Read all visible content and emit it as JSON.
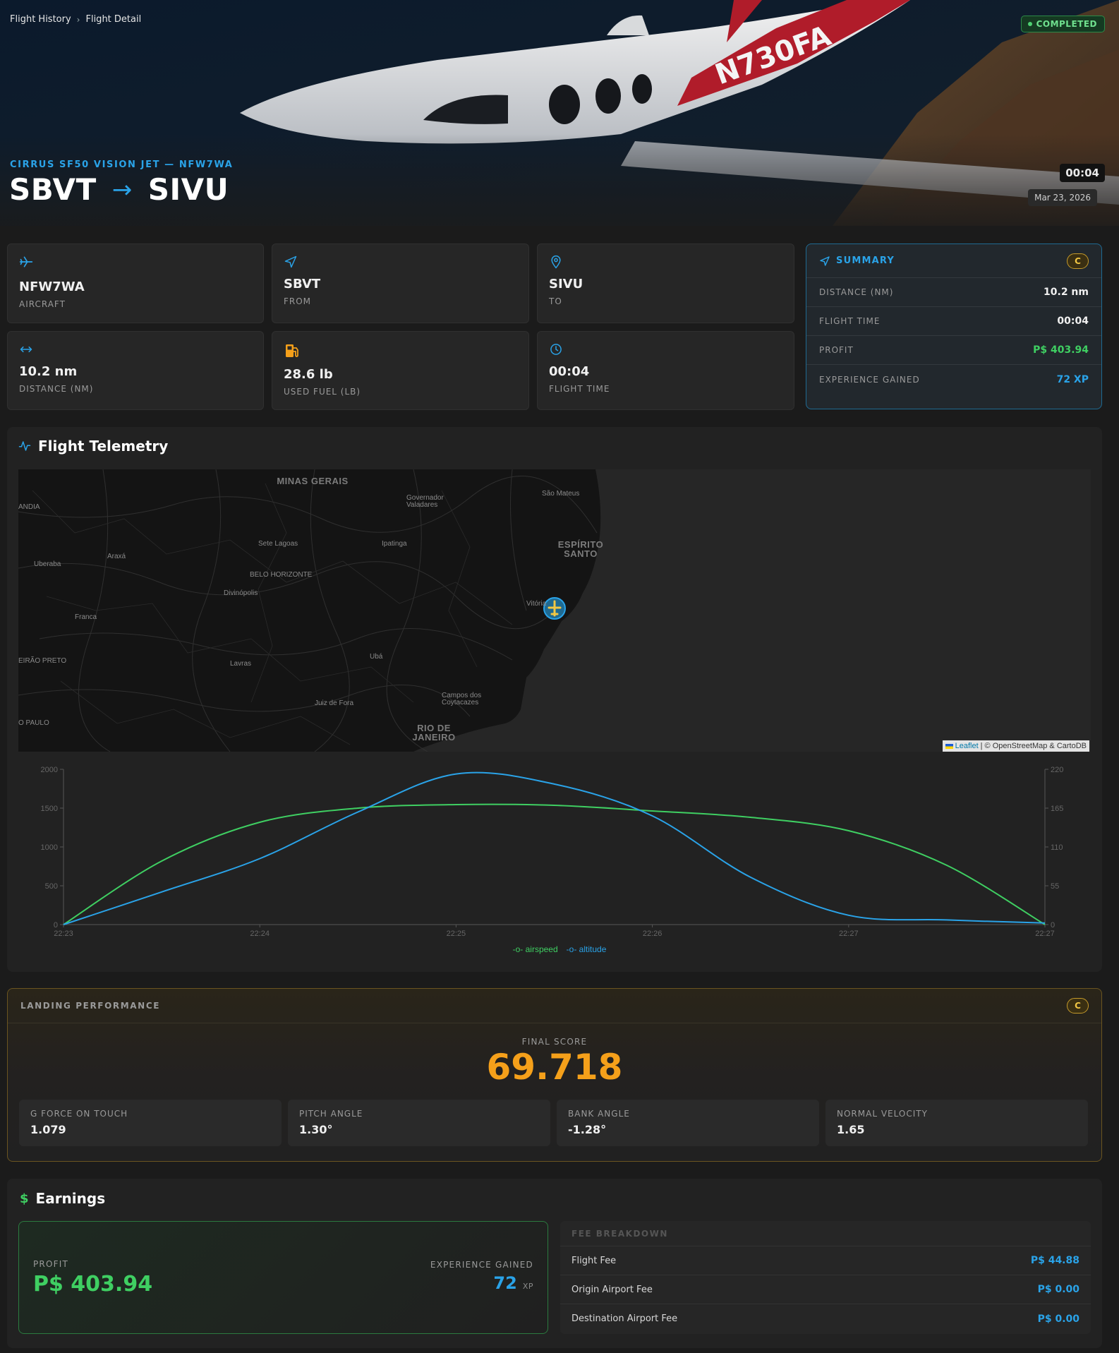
{
  "breadcrumb": {
    "items": [
      "Flight History",
      "Flight Detail"
    ],
    "separator": "›"
  },
  "status_badge": "COMPLETED",
  "header": {
    "aircraft_line": "CIRRUS SF50 VISION JET — NFW7WA",
    "origin": "SBVT",
    "arrow": "→",
    "destination": "SIVU",
    "duration": "00:04",
    "date": "Mar 23, 2026",
    "hero_tail_text": "N730FA"
  },
  "stats": [
    {
      "icon": "plane-icon",
      "value": "NFW7WA",
      "label": "AIRCRAFT"
    },
    {
      "icon": "navigation-arrow-icon",
      "value": "SBVT",
      "label": "FROM"
    },
    {
      "icon": "map-pin-icon",
      "value": "SIVU",
      "label": "TO"
    },
    {
      "icon": "distance-arrows-icon",
      "value": "10.2 nm",
      "label": "DISTANCE (NM)"
    },
    {
      "icon": "fuel-pump-icon",
      "value": "28.6 lb",
      "label": "USED FUEL (LB)"
    },
    {
      "icon": "clock-icon",
      "value": "00:04",
      "label": "FLIGHT TIME"
    }
  ],
  "summary": {
    "title": "SUMMARY",
    "grade": "C",
    "rows": [
      {
        "label": "DISTANCE (NM)",
        "value": "10.2 nm",
        "color": "#f0f0f0"
      },
      {
        "label": "FLIGHT TIME",
        "value": "00:04",
        "color": "#f0f0f0"
      },
      {
        "label": "PROFIT",
        "value": "P$ 403.94",
        "color": "#3fcf62"
      },
      {
        "label": "EXPERIENCE GAINED",
        "value": "72 XP",
        "color": "#2aa3e8"
      }
    ]
  },
  "telemetry": {
    "title": "Flight Telemetry",
    "map": {
      "attribution_link": "Leaflet",
      "attribution_text": "| © OpenStreetMap & CartoDB",
      "labels": [
        {
          "text": "MINAS GERAIS",
          "big": true
        },
        {
          "text": "São Mateus"
        },
        {
          "text": "Governador Valadares"
        },
        {
          "text": "ANDIA"
        },
        {
          "text": "Sete Lagoas"
        },
        {
          "text": "Ipatinga"
        },
        {
          "text": "ESPÍRITO SANTO",
          "big": true
        },
        {
          "text": "Uberaba"
        },
        {
          "text": "Araxá"
        },
        {
          "text": "BELO HORIZONTE"
        },
        {
          "text": "Divinópolis"
        },
        {
          "text": "Vitória"
        },
        {
          "text": "Franca"
        },
        {
          "text": "EIRÃO PRETO"
        },
        {
          "text": "Lavras"
        },
        {
          "text": "Ubá"
        },
        {
          "text": "Juiz de Fora"
        },
        {
          "text": "Campos dos Coytacazes"
        },
        {
          "text": "O PAULO"
        },
        {
          "text": "RIO DE JANEIRO",
          "big": true
        }
      ]
    }
  },
  "chart_data": {
    "type": "line",
    "x": [
      "22:23",
      "22:24",
      "22:25",
      "22:26",
      "22:27",
      "22:27"
    ],
    "x_positions_minutes": [
      0,
      1,
      2,
      3,
      4,
      5
    ],
    "series": [
      {
        "name": "airspeed",
        "axis": "right",
        "color": "#3fcf62",
        "points": [
          [
            0,
            0
          ],
          [
            0.5,
            90
          ],
          [
            1,
            145
          ],
          [
            1.5,
            165
          ],
          [
            2,
            170
          ],
          [
            2.5,
            169
          ],
          [
            3,
            161
          ],
          [
            3.5,
            152
          ],
          [
            4,
            133
          ],
          [
            4.5,
            84
          ],
          [
            5,
            0
          ]
        ]
      },
      {
        "name": "altitude",
        "axis": "left",
        "color": "#2aa3e8",
        "points": [
          [
            0,
            0
          ],
          [
            0.5,
            420
          ],
          [
            1,
            850
          ],
          [
            1.5,
            1450
          ],
          [
            2,
            1940
          ],
          [
            2.5,
            1810
          ],
          [
            3,
            1400
          ],
          [
            3.5,
            610
          ],
          [
            4,
            120
          ],
          [
            4.5,
            60
          ],
          [
            5,
            20
          ]
        ]
      }
    ],
    "y_left": {
      "ticks": [
        0,
        500,
        1000,
        1500,
        2000
      ],
      "range": [
        0,
        2000
      ]
    },
    "y_right": {
      "ticks": [
        0,
        55,
        110,
        165,
        220
      ],
      "range": [
        0,
        220
      ]
    },
    "legend": [
      "airspeed",
      "altitude"
    ]
  },
  "landing": {
    "title": "LANDING PERFORMANCE",
    "grade": "C",
    "final_score_label": "FINAL SCORE",
    "final_score": "69.718",
    "metrics": [
      {
        "label": "G FORCE ON TOUCH",
        "value": "1.079"
      },
      {
        "label": "PITCH ANGLE",
        "value": "1.30°"
      },
      {
        "label": "BANK ANGLE",
        "value": "-1.28°"
      },
      {
        "label": "NORMAL VELOCITY",
        "value": "1.65"
      }
    ]
  },
  "earnings": {
    "title": "Earnings",
    "profit_label": "PROFIT",
    "profit": "P$ 403.94",
    "xp_label": "EXPERIENCE GAINED",
    "xp": "72",
    "xp_unit": "XP",
    "fee_breakdown_title": "FEE BREAKDOWN",
    "fees": [
      {
        "label": "Flight Fee",
        "value": "P$ 44.88"
      },
      {
        "label": "Origin Airport Fee",
        "value": "P$ 0.00"
      },
      {
        "label": "Destination Airport Fee",
        "value": "P$ 0.00"
      }
    ]
  }
}
